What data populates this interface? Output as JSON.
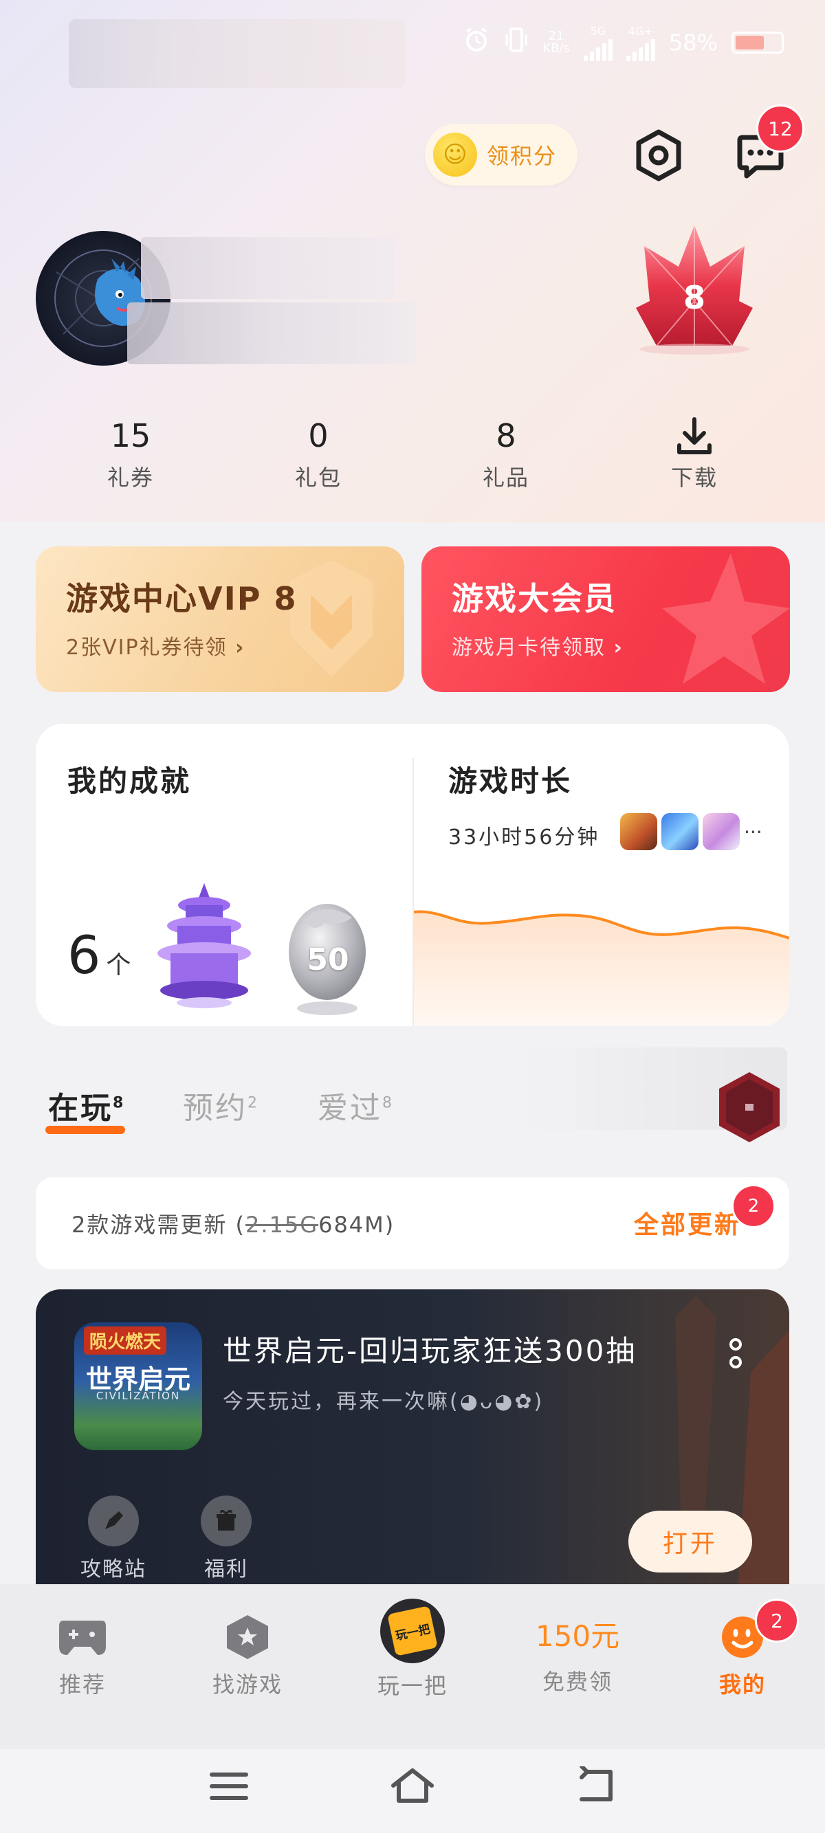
{
  "header": {
    "points_button": "领积分",
    "messages_badge": "12"
  },
  "status": {
    "speed_value": "21",
    "speed_unit": "KB/s",
    "net1": "5G",
    "net2": "4G+",
    "battery": "58%"
  },
  "profile": {
    "vip_level": "8"
  },
  "stats": [
    {
      "value": "15",
      "label": "礼券"
    },
    {
      "value": "0",
      "label": "礼包"
    },
    {
      "value": "8",
      "label": "礼品"
    },
    {
      "value": "",
      "label": "下载"
    }
  ],
  "vip_cards": {
    "center": {
      "title": "游戏中心VIP 8",
      "subtitle": "2张VIP礼券待领"
    },
    "member": {
      "title": "游戏大会员",
      "subtitle": "游戏月卡待领取"
    }
  },
  "achievements": {
    "title": "我的成就",
    "count": "6",
    "unit": "个",
    "badge_number": "50"
  },
  "playtime": {
    "title": "游戏时长",
    "duration": "33小时56分钟",
    "more": "···"
  },
  "tabs": [
    {
      "label": "在玩",
      "count": "8"
    },
    {
      "label": "预约",
      "count": "2"
    },
    {
      "label": "爱过",
      "count": "8"
    }
  ],
  "update_bar": {
    "text_prefix": "2款游戏需更新 (",
    "old_size": "2.15G",
    "new_size": "684M",
    "text_suffix": ")",
    "action": "全部更新",
    "badge": "2"
  },
  "game_card": {
    "icon_top": "陨火燃天",
    "icon_name": "世界启元",
    "icon_en": "CIVILIZATION",
    "title": "世界启元-回归玩家狂送300抽",
    "subtitle": "今天玩过，再来一次嘛(◕ᴗ◕✿)",
    "action1": "攻略站",
    "action2": "福利",
    "open_button": "打开"
  },
  "bottom_nav": [
    {
      "label": "推荐",
      "active": false
    },
    {
      "label": "找游戏",
      "active": false
    },
    {
      "label": "玩一把",
      "active": false
    },
    {
      "label": "免费领",
      "top": "150元",
      "active": false
    },
    {
      "label": "我的",
      "active": true,
      "badge": "2"
    }
  ],
  "play_icon_text": "玩一把",
  "colors": {
    "accent": "#ff7a1a",
    "active_nav": "#ff6f0f",
    "badge_red": "#f4364c",
    "vip_red": "#f7394a"
  }
}
